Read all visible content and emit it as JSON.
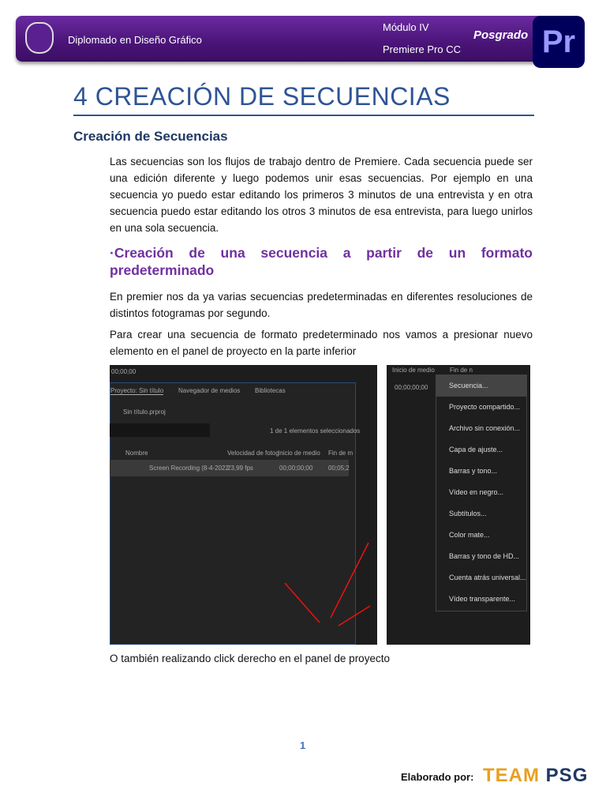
{
  "header": {
    "course": "Diplomado en Diseño Gráfico",
    "module": "Módulo IV",
    "subject": "Premiere Pro CC",
    "brand": "Posgrado",
    "app_icon": "Pr"
  },
  "title": "4 CREACIÓN DE SECUENCIAS",
  "section_title": "Creación de Secuencias",
  "intro": "Las secuencias son los flujos de trabajo dentro de Premiere. Cada secuencia  puede ser una edición diferente y luego podemos unir esas secuencias. Por  ejemplo en una secuencia yo puedo estar editando los primeros 3 minutos de una  entrevista y en otra secuencia puedo estar editando los otros 3 minutos de esa  entrevista, para luego unirlos en una sola secuencia.",
  "subsection_title": "·Creación de una secuencia a partir de un formato predeterminado",
  "para1": "En premier nos da ya varias secuencias predeterminadas en diferentes resoluciones de distintos fotogramas por segundo.",
  "para2": "Para crear una secuencia de formato predeterminado nos vamos a presionar nuevo elemento en el panel de proyecto en la parte inferior",
  "screenshot_left": {
    "timecode": "00;00;00",
    "tabs": [
      "Proyecto: Sin título",
      "Navegador de medios",
      "Bibliotecas"
    ],
    "project_file": "Sin título.prproj",
    "selection": "1 de 1 elementos seleccionados",
    "columns": [
      "Nombre",
      "Velocidad de fotog",
      "Inicio de medio",
      "Fin de m"
    ],
    "row": [
      "Screen Recording (8-4-2022",
      "23,99 fps",
      "00;00;00;00",
      "00;05;2"
    ]
  },
  "screenshot_right": {
    "columns": [
      "Inicio de medio",
      "Fin de n"
    ],
    "timecode": "00;00;00;00",
    "menu": [
      "Secuencia...",
      "Proyecto compartido...",
      "Archivo sin conexión...",
      "Capa de ajuste...",
      "Barras y tono...",
      "Vídeo en negro...",
      "Subtítulos...",
      "Color mate...",
      "Barras y tono de HD...",
      "Cuenta atrás universal...",
      "Vídeo transparente..."
    ]
  },
  "caption": "O también realizando click derecho en el panel de proyecto",
  "footer": {
    "page": "1",
    "made_by": "Elaborado por:",
    "logo_a": "TEAM",
    "logo_b": "PSG"
  }
}
